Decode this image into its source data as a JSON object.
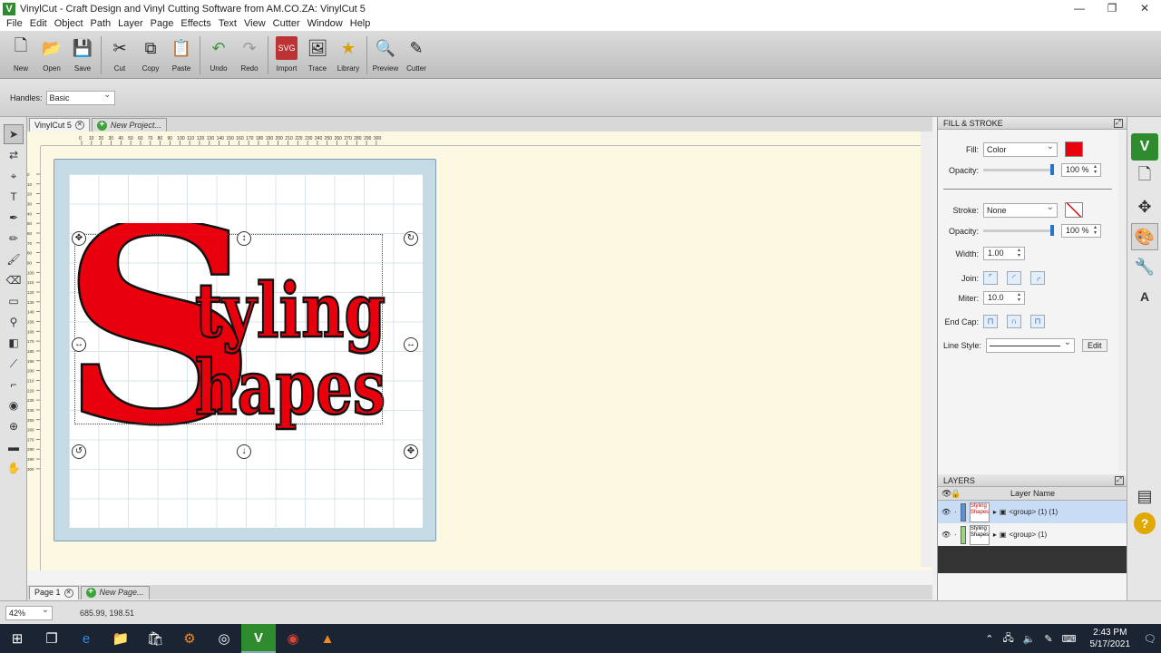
{
  "window": {
    "title": "VinylCut - Craft Design and Vinyl Cutting Software from AM.CO.ZA: VinylCut 5",
    "app_icon": "V"
  },
  "menu": [
    "File",
    "Edit",
    "Object",
    "Path",
    "Layer",
    "Page",
    "Effects",
    "Text",
    "View",
    "Cutter",
    "Window",
    "Help"
  ],
  "toolbar": {
    "new": "New",
    "open": "Open",
    "save": "Save",
    "cut": "Cut",
    "copy": "Copy",
    "paste": "Paste",
    "undo": "Undo",
    "redo": "Redo",
    "import": "Import",
    "trace": "Trace",
    "library": "Library",
    "preview": "Preview",
    "cutter": "Cutter"
  },
  "options": {
    "handles_label": "Handles:",
    "handles_value": "Basic"
  },
  "tabs": {
    "doc": "VinylCut 5",
    "new_project": "New Project..."
  },
  "ruler": {
    "h": [
      "0",
      "10",
      "20",
      "30",
      "40",
      "50",
      "60",
      "70",
      "80",
      "90",
      "100",
      "110",
      "120",
      "130",
      "140",
      "150",
      "160",
      "170",
      "180",
      "190",
      "200",
      "210",
      "220",
      "230",
      "240",
      "250",
      "260",
      "270",
      "280",
      "290",
      "300"
    ],
    "v": [
      "0",
      "10",
      "20",
      "30",
      "40",
      "50",
      "60",
      "70",
      "80",
      "90",
      "100",
      "110",
      "120",
      "130",
      "140",
      "150",
      "160",
      "170",
      "180",
      "190",
      "200",
      "210",
      "220",
      "230",
      "240",
      "250",
      "260",
      "270",
      "280",
      "290",
      "300"
    ]
  },
  "artwork": {
    "big_letter": "S",
    "line1": "tyling",
    "line2": "hapes",
    "fill_color": "#e8000d",
    "stroke_color": "#111111"
  },
  "pages": {
    "page": "Page 1",
    "new_page": "New Page..."
  },
  "fill_stroke": {
    "title": "FILL & STROKE",
    "fill_label": "Fill:",
    "fill_value": "Color",
    "fill_color": "#e8000d",
    "opacity_label": "Opacity:",
    "fill_opacity": "100 %",
    "stroke_label": "Stroke:",
    "stroke_value": "None",
    "stroke_opacity": "100 %",
    "width_label": "Width:",
    "width_value": "1.00",
    "join_label": "Join:",
    "miter_label": "Miter:",
    "miter_value": "10.0",
    "endcap_label": "End Cap:",
    "linestyle_label": "Line Style:",
    "edit": "Edit"
  },
  "layers": {
    "title": "LAYERS",
    "header": "Layer Name",
    "rows": [
      {
        "name": "<group> (1) (1)",
        "color": "#5b8fd6",
        "thumb": "Styling Shapes"
      },
      {
        "name": "<group> (1)",
        "color": "#9ed47a",
        "thumb": "Styling Shapes"
      }
    ]
  },
  "status": {
    "zoom": "42%",
    "coords": "685.99, 198.51"
  },
  "taskbar": {
    "time": "2:43 PM",
    "date": "5/17/2021"
  }
}
